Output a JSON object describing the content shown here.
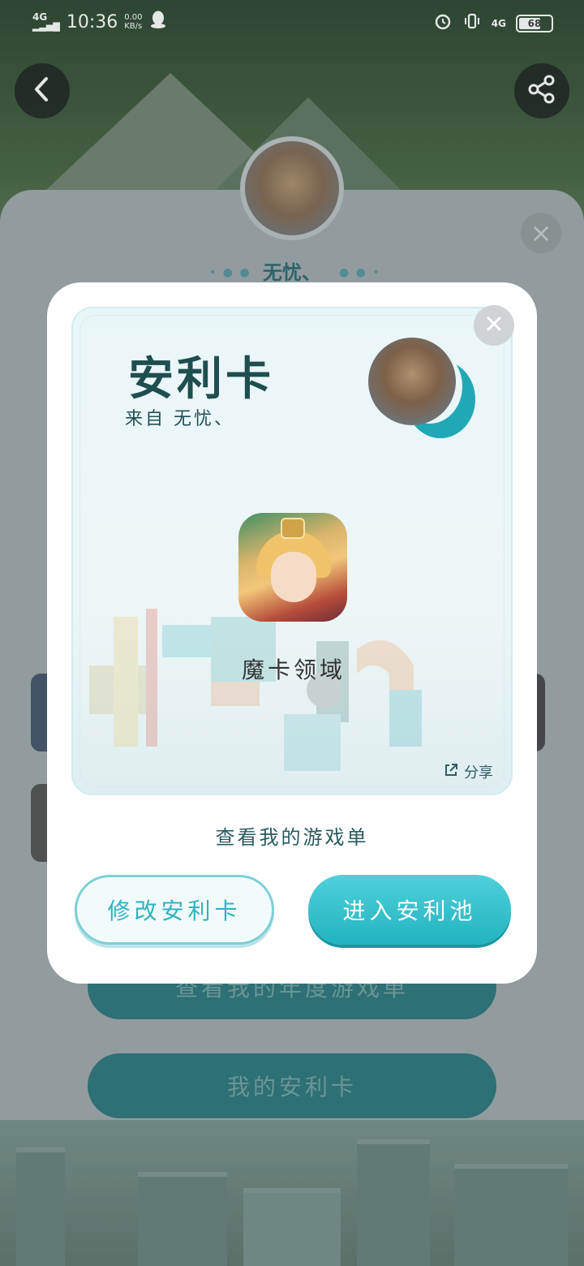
{
  "status_bar": {
    "network": "4G",
    "time": "10:36",
    "speed_value": "0.00",
    "speed_unit": "KB/s",
    "network_right": "4G",
    "battery": "68"
  },
  "profile": {
    "name": "无忧、"
  },
  "background_buttons": {
    "annual_list": "查看我的年度游戏单",
    "my_card": "我的安利卡"
  },
  "card": {
    "title": "安利卡",
    "from": "来自 无忧、",
    "game_name": "魔卡领域",
    "share_label": "分享"
  },
  "modal": {
    "view_list": "查看我的游戏单",
    "edit_button": "修改安利卡",
    "enter_button": "进入安利池"
  },
  "colors": {
    "accent": "#22b3c1",
    "title_text": "#1f4e4f"
  }
}
